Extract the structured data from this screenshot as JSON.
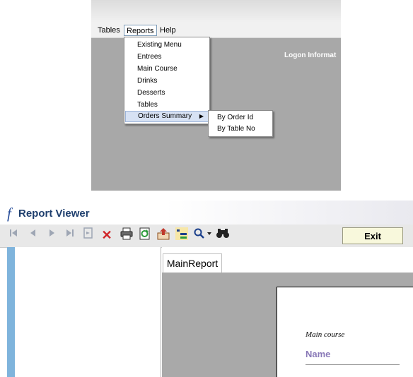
{
  "top_app": {
    "menubar": {
      "items": [
        "Tables",
        "Reports",
        "Help"
      ]
    },
    "reports_menu": {
      "items": [
        "Existing Menu",
        "Entrees",
        "Main Course",
        "Drinks",
        "Desserts",
        "Tables",
        "Orders Summary"
      ],
      "highlighted": "Orders Summary"
    },
    "orders_submenu": {
      "items": [
        "By Order Id",
        "By Table No"
      ]
    },
    "logon_text": "Logon Informat"
  },
  "report_viewer": {
    "title": "Report Viewer",
    "logo_glyph": "f",
    "toolbar": {
      "icons": [
        "first-page-icon",
        "previous-page-icon",
        "next-page-icon",
        "last-page-icon",
        "goto-page-icon",
        "close-icon",
        "print-icon",
        "refresh-icon",
        "export-icon",
        "toggle-tree-icon",
        "zoom-icon",
        "search-icon"
      ],
      "exit_label": "Exit"
    },
    "tab_label": "MainReport",
    "report": {
      "section_title": "Main course",
      "column_header": "Name"
    },
    "colors": {
      "title": "#1f3f6e",
      "accent_rail": "#7fb4dc",
      "name_header": "#8a7ab8"
    }
  }
}
